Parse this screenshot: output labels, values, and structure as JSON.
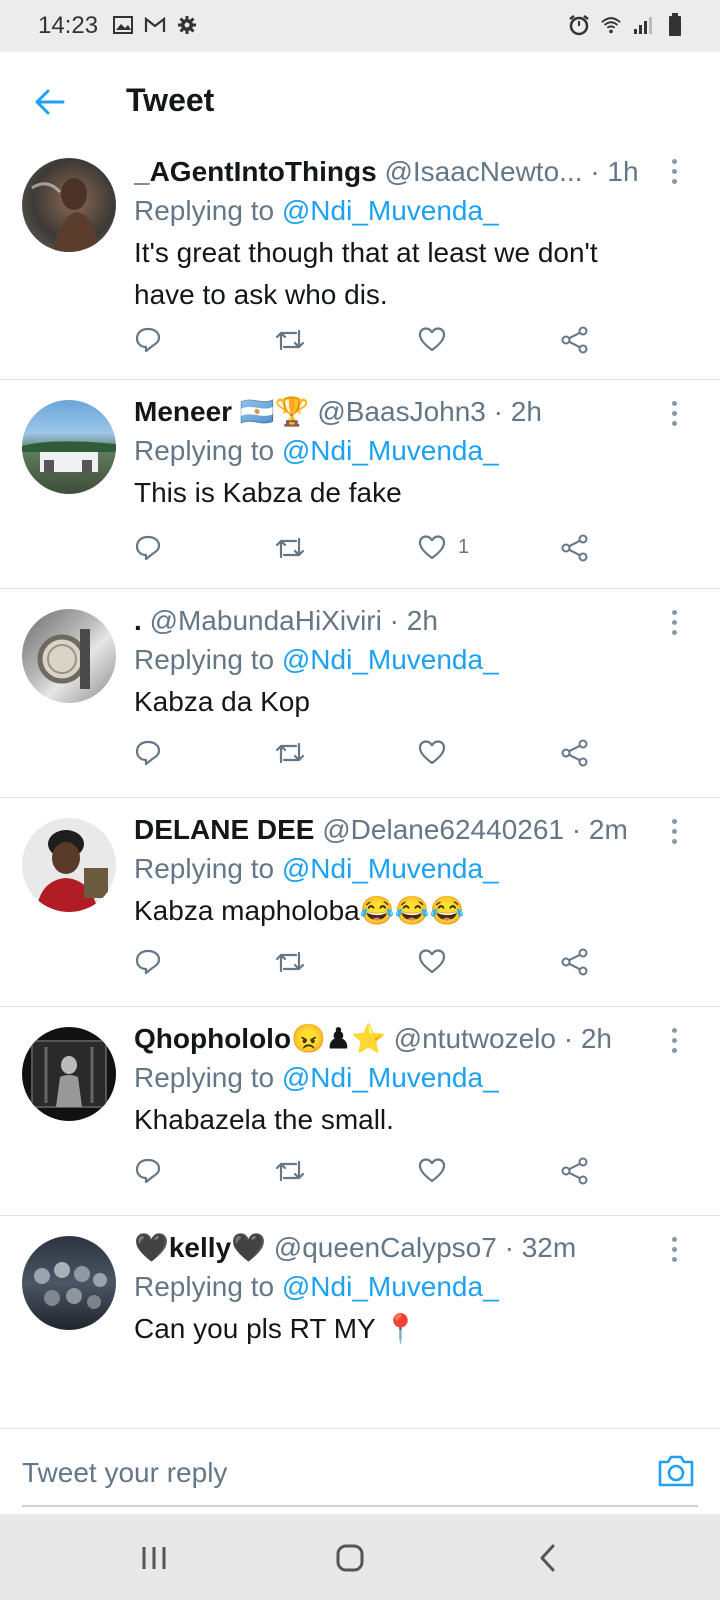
{
  "status_bar": {
    "time": "14:23",
    "left_icons": [
      "image-icon",
      "gmail-icon",
      "settings-icon"
    ],
    "right_icons": [
      "alarm-icon",
      "wifi-icon",
      "signal-icon",
      "battery-icon"
    ]
  },
  "header": {
    "back_icon": "back-arrow-icon",
    "title": "Tweet"
  },
  "colors": {
    "accent": "#1da1f2",
    "secondary_text": "#657786",
    "primary_text": "#14171a"
  },
  "replying_label": "Replying to",
  "tweets": [
    {
      "name": "_AGentIntoThings",
      "handle": "@IsaacNewto...",
      "time": "· 1h",
      "replying_to": "@Ndi_Muvenda_",
      "text": "It's great though that at least we don't have to ask who dis.",
      "like_count": ""
    },
    {
      "name": "Meneer 🇦🇷🏆",
      "handle": "@BaasJohn3",
      "time": "· 2h",
      "replying_to": "@Ndi_Muvenda_",
      "text": "This is Kabza de fake",
      "like_count": "1"
    },
    {
      "name": ".",
      "handle": "@MabundaHiXiviri",
      "time": "· 2h",
      "replying_to": "@Ndi_Muvenda_",
      "text": "Kabza da Kop",
      "like_count": ""
    },
    {
      "name": "DELANE DEE",
      "handle": "@Delane62440261",
      "time": "· 2m",
      "replying_to": "@Ndi_Muvenda_",
      "text": "Kabza mapholoba😂😂😂",
      "like_count": ""
    },
    {
      "name": "Qhophololo😠♟⭐",
      "handle": "@ntutwozelo",
      "time": "· 2h",
      "replying_to": "@Ndi_Muvenda_",
      "text": "Khabazela the small.",
      "like_count": ""
    },
    {
      "name": "🖤kelly🖤",
      "handle": "@queenCalypso7",
      "time": "· 32m",
      "replying_to": "@Ndi_Muvenda_",
      "text": "Can you pls RT MY 📍",
      "like_count": ""
    }
  ],
  "reply_bar": {
    "placeholder": "Tweet your reply",
    "camera_icon": "camera-icon"
  },
  "nav_bar": {
    "icons": [
      "recent-apps-icon",
      "home-icon",
      "back-icon"
    ]
  }
}
